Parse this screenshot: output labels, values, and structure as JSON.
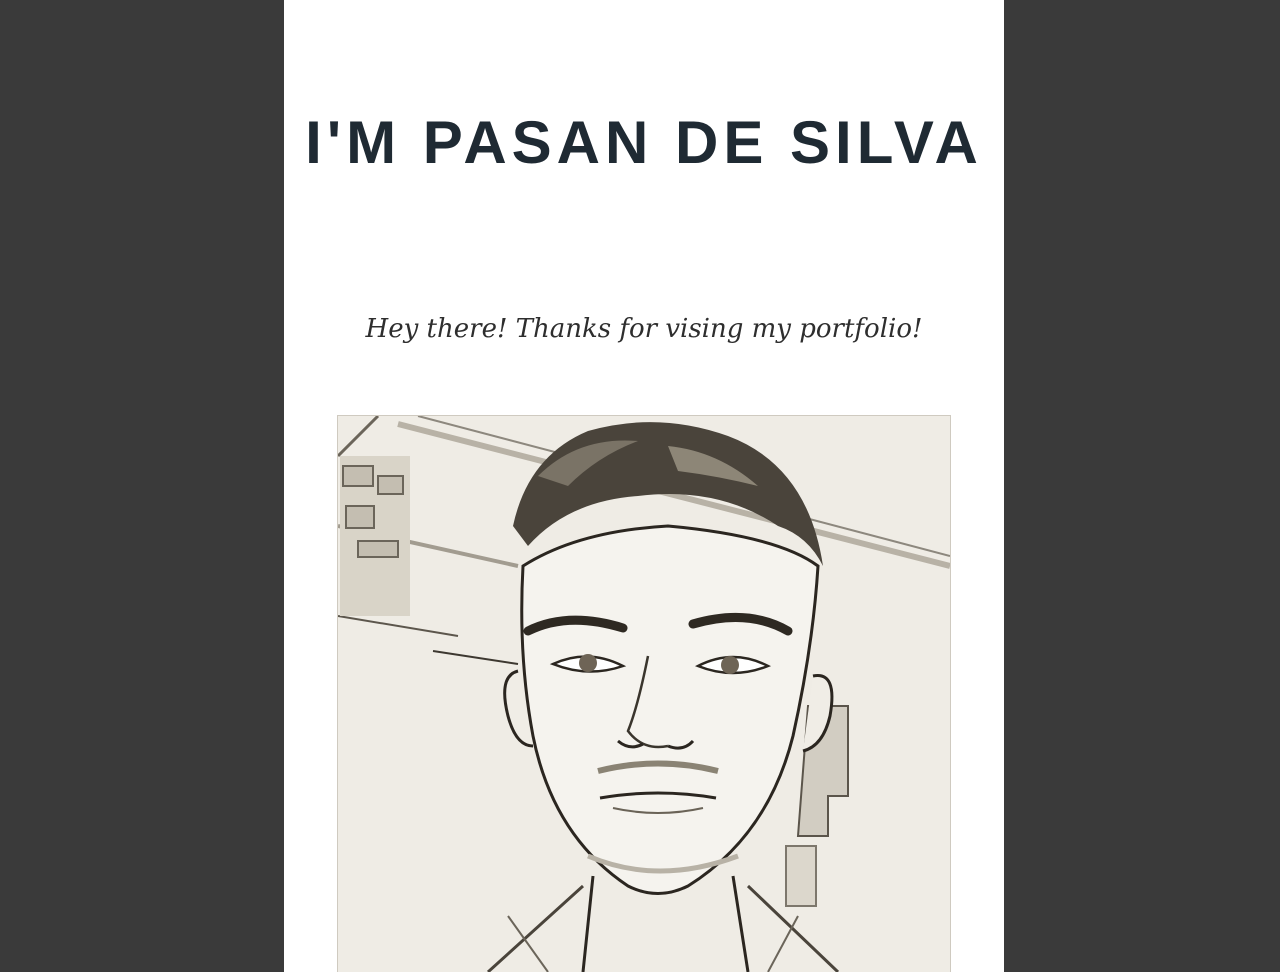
{
  "header": {
    "title": "I'M PASAN DE SILVA",
    "subtitle": "Hey there! Thanks for vising my portfolio!"
  },
  "photo": {
    "description_icon": "profile-sketch-photo"
  },
  "colors": {
    "background": "#3a3a3a",
    "page": "#ffffff",
    "title": "#1f2a33",
    "subtitle": "#2e2e2e"
  }
}
